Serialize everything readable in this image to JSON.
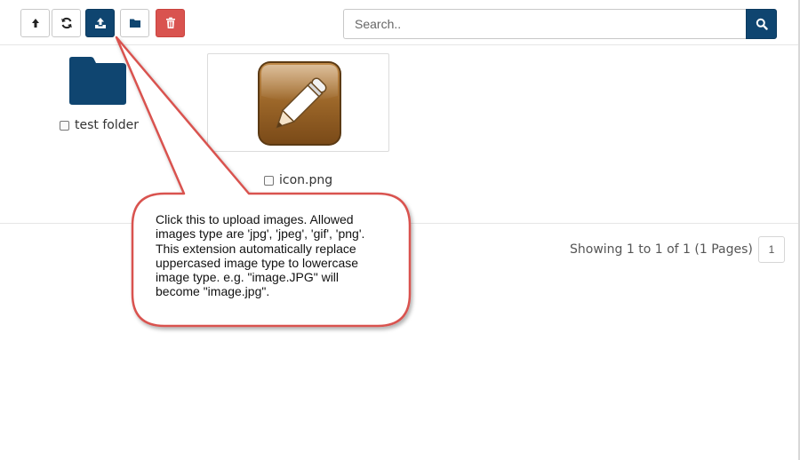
{
  "toolbar": {
    "buttons": [
      {
        "name": "up-directory-button",
        "icon": "arrow-up-icon"
      },
      {
        "name": "refresh-button",
        "icon": "refresh-icon"
      },
      {
        "name": "upload-button",
        "icon": "upload-icon",
        "active": true
      },
      {
        "name": "new-folder-button",
        "icon": "folder-icon"
      },
      {
        "name": "delete-button",
        "icon": "trash-icon"
      }
    ]
  },
  "search": {
    "placeholder": "Search..",
    "value": "",
    "button_icon": "search-icon"
  },
  "files": [
    {
      "type": "folder",
      "label": "test folder",
      "icon": "folder-icon",
      "checked": false
    },
    {
      "type": "image",
      "label": "icon.png",
      "icon": "pencil-icon",
      "checked": false
    }
  ],
  "pagination": {
    "info": "Showing 1 to 1 of 1 (1 Pages)",
    "current_page": "1"
  },
  "callout": {
    "lines": [
      "Click this to upload images. Allowed",
      "images type are 'jpg', 'jpeg', 'gif', 'png'.",
      "This extension automatically replace",
      "uppercased image type to lowercase",
      "image type. e.g. \"image.JPG\" will",
      "become \"image.jpg\"."
    ]
  },
  "colors": {
    "primary": "#0f4570",
    "danger": "#d9534f",
    "callout_border": "#d9534f",
    "folder": "#0f4570",
    "icon_bronze": "#8a5a22"
  }
}
